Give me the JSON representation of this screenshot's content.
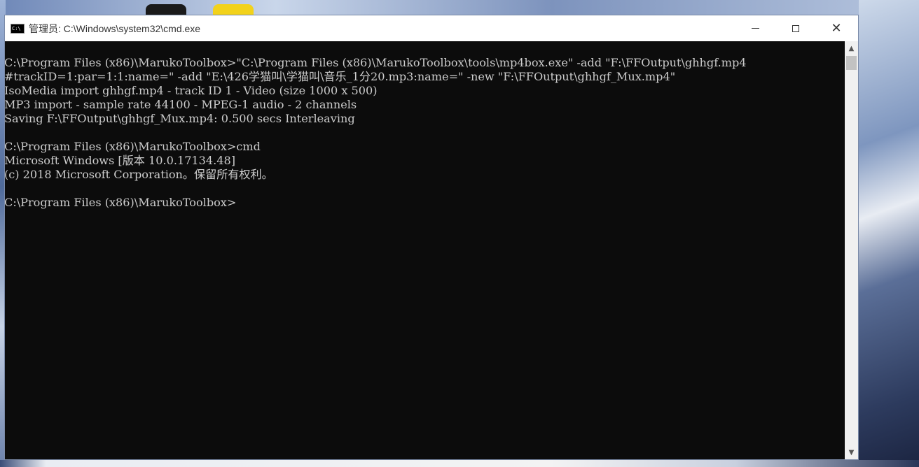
{
  "window": {
    "title": "管理员: C:\\Windows\\system32\\cmd.exe",
    "icon": "cmd-icon"
  },
  "controls": {
    "minimize_icon": "minimize-icon",
    "maximize_icon": "maximize-icon",
    "close_icon": "close-icon",
    "close_glyph": "✕"
  },
  "console": {
    "lines": [
      "C:\\Program Files (x86)\\MarukoToolbox>\"C:\\Program Files (x86)\\MarukoToolbox\\tools\\mp4box.exe\" -add \"F:\\FFOutput\\ghhgf.mp4",
      "#trackID=1:par=1:1:name=\" -add \"E:\\426学猫叫\\学猫叫\\音乐_1分20.mp3:name=\" -new \"F:\\FFOutput\\ghhgf_Mux.mp4\"",
      "IsoMedia import ghhgf.mp4 - track ID 1 - Video (size 1000 x 500)",
      "MP3 import - sample rate 44100 - MPEG-1 audio - 2 channels",
      "Saving F:\\FFOutput\\ghhgf_Mux.mp4: 0.500 secs Interleaving",
      "",
      "C:\\Program Files (x86)\\MarukoToolbox>cmd",
      "Microsoft Windows [版本 10.0.17134.48]",
      "(c) 2018 Microsoft Corporation。保留所有权利。",
      "",
      "C:\\Program Files (x86)\\MarukoToolbox>"
    ]
  },
  "scrollbar": {
    "up_glyph": "▲",
    "down_glyph": "▼"
  },
  "colors": {
    "console_bg": "#0c0c0c",
    "console_text": "#cccccc",
    "titlebar_bg": "#ffffff"
  }
}
